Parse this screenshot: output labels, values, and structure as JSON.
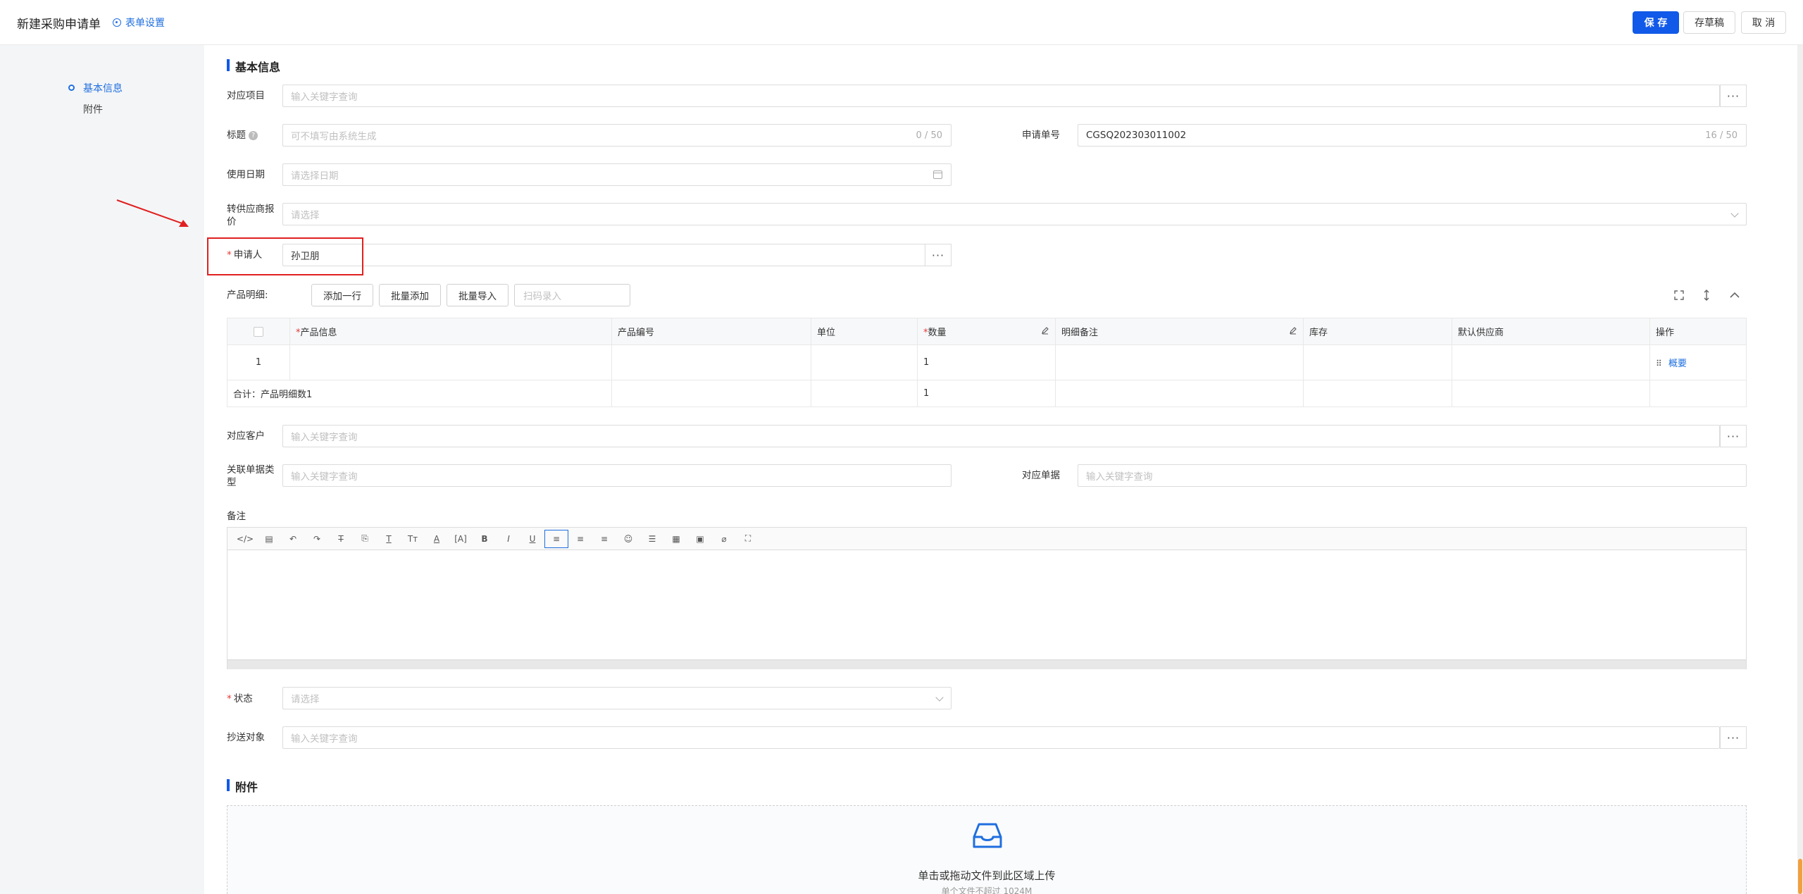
{
  "header": {
    "title": "新建采购申请单",
    "settings_label": "表单设置",
    "save_label": "保 存",
    "draft_label": "存草稿",
    "cancel_label": "取 消"
  },
  "nav": {
    "items": [
      {
        "label": "基本信息"
      },
      {
        "label": "附件"
      }
    ]
  },
  "basic": {
    "section_title": "基本信息",
    "project": {
      "label": "对应项目",
      "placeholder": "输入关键字查询"
    },
    "title_field": {
      "label": "标题",
      "placeholder": "可不填写由系统生成",
      "count": "0 / 50"
    },
    "apply_no": {
      "label": "申请单号",
      "value": "CGSQ202303011002",
      "count": "16 / 50"
    },
    "use_date": {
      "label": "使用日期",
      "placeholder": "请选择日期"
    },
    "supplier_quote": {
      "label": "转供应商报价",
      "placeholder": "请选择"
    },
    "applicant": {
      "label": "申请人",
      "value": "孙卫朋"
    },
    "product_detail_label": "产品明细:",
    "add_row": "添加一行",
    "batch_add": "批量添加",
    "batch_import": "批量导入",
    "scan_placeholder": "扫码录入",
    "customer": {
      "label": "对应客户",
      "placeholder": "输入关键字查询"
    },
    "rel_type": {
      "label": "关联单据类型",
      "placeholder": "输入关键字查询"
    },
    "rel_doc": {
      "label": "对应单据",
      "placeholder": "输入关键字查询"
    },
    "remark_label": "备注",
    "status": {
      "label": "状态",
      "placeholder": "请选择"
    },
    "cc": {
      "label": "抄送对象",
      "placeholder": "输入关键字查询"
    }
  },
  "table": {
    "headers": [
      "产品信息",
      "产品编号",
      "单位",
      "数量",
      "明细备注",
      "库存",
      "默认供应商",
      "操作"
    ],
    "row1": {
      "index": "1",
      "qty": "1",
      "action": "概要"
    },
    "total": {
      "label": "合计：产品明细数1",
      "qty": "1"
    }
  },
  "attach": {
    "section_title": "附件",
    "upload_text": "单击或拖动文件到此区域上传",
    "upload_hint": "单个文件不超过 1024M"
  },
  "colors": {
    "primary": "#1159e8",
    "link": "#1f6fdf",
    "required": "#e53935",
    "annotation": "#e02020"
  }
}
